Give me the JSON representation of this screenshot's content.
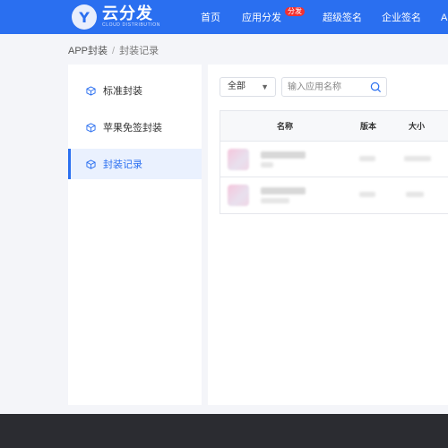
{
  "header": {
    "logo_letter": "Y",
    "logo_title": "云分发",
    "logo_subtitle": "CLOUD DISTRIBUTION",
    "nav": [
      {
        "label": "首页"
      },
      {
        "label": "应用分发",
        "badge": "分发"
      },
      {
        "label": "超级签名"
      },
      {
        "label": "企业签名"
      },
      {
        "label": "A"
      }
    ],
    "accent_color": "#2a6ff0"
  },
  "breadcrumb": {
    "root": "APP封装",
    "separator": "/",
    "current": "封装记录"
  },
  "sidebar": {
    "items": [
      {
        "label": "标准封装",
        "icon": "cube-icon",
        "active": false
      },
      {
        "label": "苹果免签封装",
        "icon": "cube-icon",
        "active": false
      },
      {
        "label": "封装记录",
        "icon": "cube-icon",
        "active": true
      }
    ]
  },
  "filters": {
    "select_value": "全部",
    "search_placeholder": "输入应用名称"
  },
  "table": {
    "headers": [
      "名称",
      "版本",
      "大小"
    ],
    "rows": [
      {
        "name": "",
        "version": "",
        "size": ""
      },
      {
        "name": "",
        "version": "",
        "size": ""
      }
    ]
  }
}
